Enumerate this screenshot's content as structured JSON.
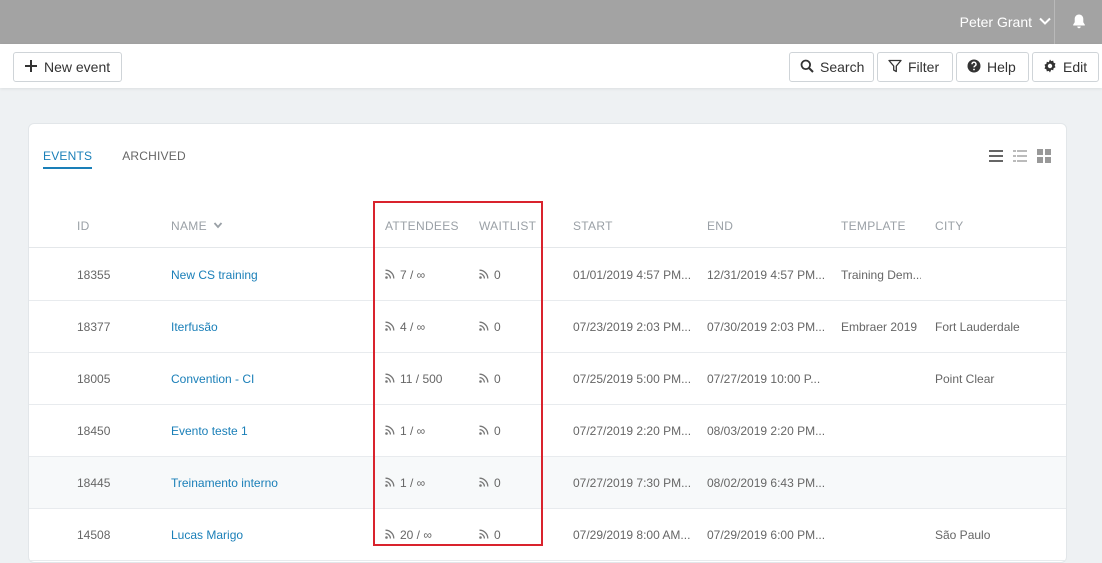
{
  "header": {
    "user_name": "Peter Grant",
    "user_icon": "chevron-down-icon",
    "bell_icon": "bell-icon"
  },
  "toolbar": {
    "new_event_label": "New event",
    "search_label": "Search",
    "filter_label": "Filter",
    "help_label": "Help",
    "edit_label": "Edit"
  },
  "tabs": {
    "events": "EVENTS",
    "archived": "ARCHIVED"
  },
  "columns": {
    "id": "ID",
    "name": "NAME",
    "attendees": "ATTENDEES",
    "waitlist": "WAITLIST",
    "start": "START",
    "end": "END",
    "template": "TEMPLATE",
    "city": "CITY"
  },
  "rows": [
    {
      "id": "18355",
      "name": "New CS training",
      "attendees": "7 / ∞",
      "waitlist": "0",
      "start": "01/01/2019 4:57 PM...",
      "end": "12/31/2019 4:57 PM...",
      "template": "Training Dem...",
      "city": ""
    },
    {
      "id": "18377",
      "name": "Iterfusão",
      "attendees": "4 / ∞",
      "waitlist": "0",
      "start": "07/23/2019 2:03 PM...",
      "end": "07/30/2019 2:03 PM...",
      "template": "Embraer 2019",
      "city": "Fort Lauderdale"
    },
    {
      "id": "18005",
      "name": "Convention - CI",
      "attendees": "11 / 500",
      "waitlist": "0",
      "start": "07/25/2019 5:00 PM...",
      "end": "07/27/2019 10:00 P...",
      "template": "",
      "city": "Point Clear"
    },
    {
      "id": "18450",
      "name": "Evento teste 1",
      "attendees": "1 / ∞",
      "waitlist": "0",
      "start": "07/27/2019 2:20 PM...",
      "end": "08/03/2019 2:20 PM...",
      "template": "",
      "city": ""
    },
    {
      "id": "18445",
      "name": "Treinamento interno",
      "attendees": "1 / ∞",
      "waitlist": "0",
      "start": "07/27/2019 7:30 PM...",
      "end": "08/02/2019 6:43 PM...",
      "template": "",
      "city": ""
    },
    {
      "id": "14508",
      "name": "Lucas Marigo",
      "attendees": "20 / ∞",
      "waitlist": "0",
      "start": "07/29/2019 8:00 AM...",
      "end": "07/29/2019 6:00 PM...",
      "template": "",
      "city": "São Paulo"
    }
  ],
  "colors": {
    "topbar": "#a3a3a3",
    "link": "#1a7fb8",
    "highlight": "#d9232d"
  }
}
